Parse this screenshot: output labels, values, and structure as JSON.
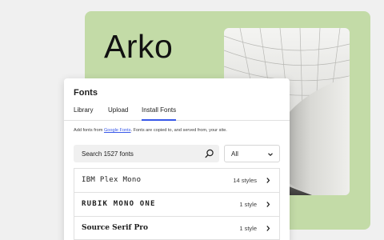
{
  "preview": {
    "title": "Arko",
    "background": "#c3dba7",
    "image": "architecture-photo"
  },
  "panel": {
    "title": "Fonts",
    "tabs": [
      {
        "label": "Library",
        "active": false
      },
      {
        "label": "Upload",
        "active": false
      },
      {
        "label": "Install Fonts",
        "active": true
      }
    ],
    "info": {
      "before": "Add fonts from ",
      "link": "Google Fonts",
      "after": ". Fonts are copied to, and served from, your site."
    },
    "search": {
      "placeholder": "Search 1527 fonts",
      "icon": "search-icon"
    },
    "filter": {
      "value": "All",
      "icon": "chevron-down-icon"
    },
    "fonts": [
      {
        "name": "IBM Plex Mono",
        "styles": "14 styles"
      },
      {
        "name": "RUBIK MONO ONE",
        "styles": "1 style"
      },
      {
        "name": "Source Serif Pro",
        "styles": "1 style"
      }
    ]
  },
  "colors": {
    "accent": "#3858e9",
    "panel_bg": "#ffffff",
    "page_bg": "#f0f0f0"
  }
}
